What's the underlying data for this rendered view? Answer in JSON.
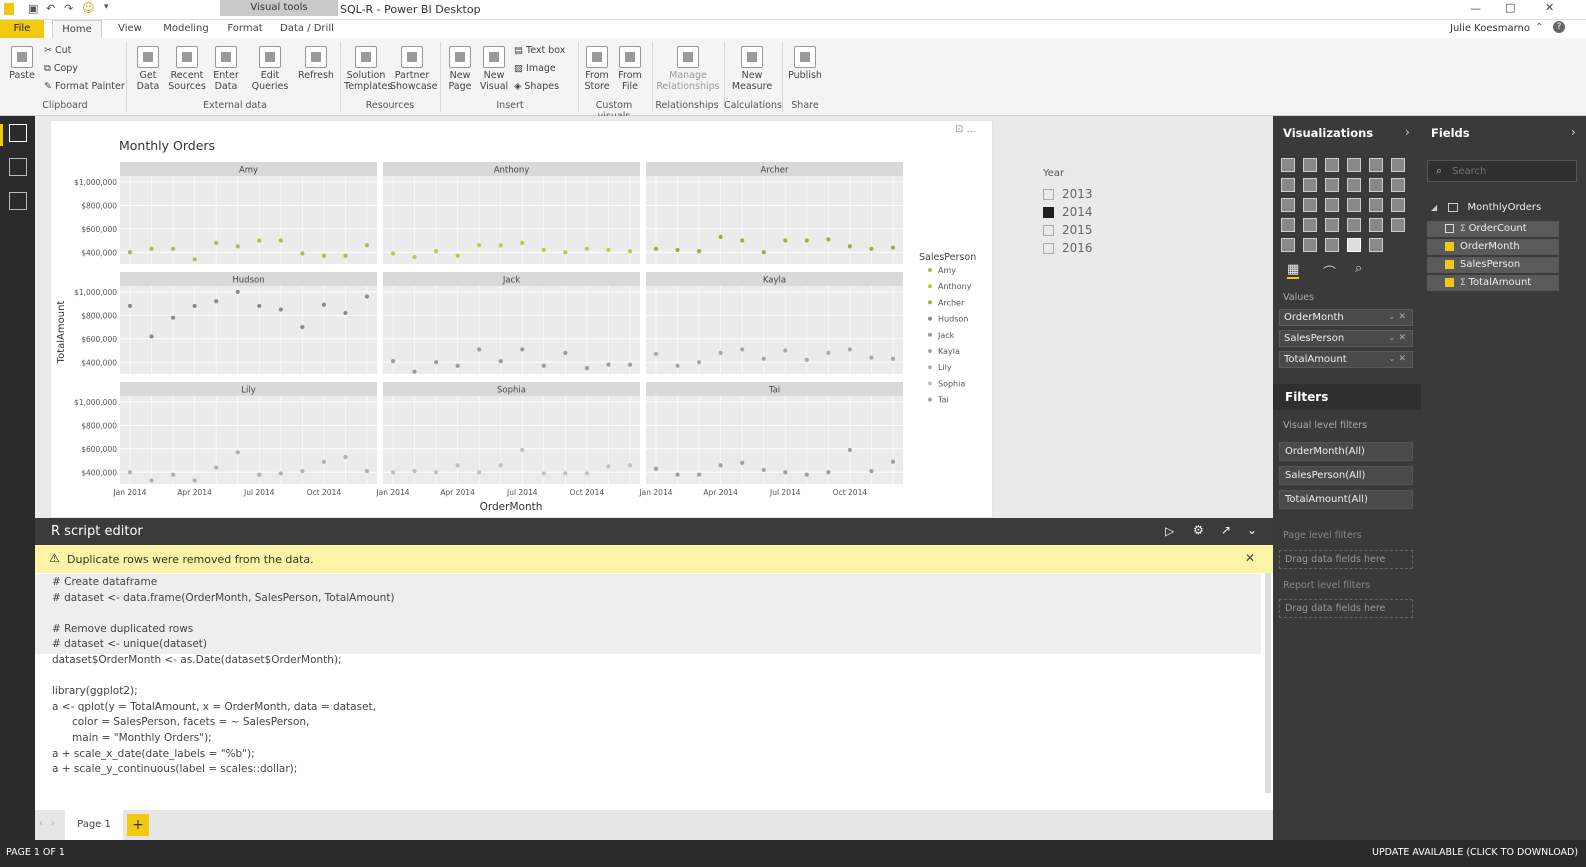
{
  "titlebar": {
    "title": "SQL-R - Power BI Desktop",
    "user": "Julie Koesmarno"
  },
  "tabs": [
    {
      "label": "File"
    },
    {
      "label": "Home"
    },
    {
      "label": "View"
    },
    {
      "label": "Modeling"
    },
    {
      "label": "Format"
    },
    {
      "label": "Data / Drill"
    }
  ],
  "visual_tools_label": "Visual tools",
  "ribbon": {
    "paste": "Paste",
    "cut": "Cut",
    "copy": "Copy",
    "format_painter": "Format Painter",
    "get_data": "Get Data",
    "recent_sources": "Recent Sources",
    "enter_data": "Enter Data",
    "edit_queries": "Edit Queries",
    "refresh": "Refresh",
    "solution_templates": "Solution Templates",
    "partner_showcase": "Partner Showcase",
    "new_page": "New Page",
    "new_visual": "New Visual",
    "text_box": "Text box",
    "image": "Image",
    "shapes": "Shapes",
    "from_store": "From Store",
    "from_file": "From File",
    "manage_relationships": "Manage Relationships",
    "new_measure": "New Measure",
    "publish": "Publish",
    "groups": [
      "Clipboard",
      "External data",
      "Resources",
      "Insert",
      "Custom visuals",
      "Relationships",
      "Calculations",
      "Share"
    ]
  },
  "chart": {
    "title": "Monthly Orders",
    "ylabel": "TotalAmount",
    "xlabel": "OrderMonth",
    "yticks": [
      "$1,000,000",
      "$800,000",
      "$600,000",
      "$400,000"
    ],
    "xticks": [
      "Jan 2014",
      "Apr 2014",
      "Jul 2014",
      "Oct 2014"
    ],
    "legend_title": "SalesPerson",
    "legend_items": [
      "Amy",
      "Anthony",
      "Archer",
      "Hudson",
      "Jack",
      "Kayla",
      "Lily",
      "Sophia",
      "Tai"
    ]
  },
  "chart_data": {
    "type": "scatter",
    "title": "Monthly Orders",
    "xlabel": "OrderMonth",
    "ylabel": "TotalAmount",
    "x": [
      "2014-01",
      "2014-02",
      "2014-03",
      "2014-04",
      "2014-05",
      "2014-06",
      "2014-07",
      "2014-08",
      "2014-09",
      "2014-10",
      "2014-11",
      "2014-12"
    ],
    "ylim": [
      300000,
      1050000
    ],
    "series": [
      {
        "name": "Amy",
        "values": [
          400000,
          430000,
          430000,
          340000,
          480000,
          450000,
          500000,
          500000,
          390000,
          370000,
          370000,
          460000
        ]
      },
      {
        "name": "Anthony",
        "values": [
          390000,
          360000,
          410000,
          370000,
          460000,
          460000,
          480000,
          420000,
          400000,
          430000,
          420000,
          410000
        ]
      },
      {
        "name": "Archer",
        "values": [
          430000,
          420000,
          410000,
          530000,
          500000,
          400000,
          500000,
          500000,
          510000,
          450000,
          430000,
          440000
        ]
      },
      {
        "name": "Hudson",
        "values": [
          880000,
          620000,
          780000,
          880000,
          920000,
          1000000,
          880000,
          850000,
          700000,
          890000,
          820000,
          960000
        ]
      },
      {
        "name": "Jack",
        "values": [
          410000,
          320000,
          400000,
          370000,
          510000,
          410000,
          510000,
          370000,
          480000,
          350000,
          380000,
          380000
        ]
      },
      {
        "name": "Kayla",
        "values": [
          470000,
          370000,
          400000,
          480000,
          510000,
          430000,
          500000,
          420000,
          480000,
          510000,
          440000,
          430000
        ]
      },
      {
        "name": "Lily",
        "values": [
          400000,
          330000,
          380000,
          330000,
          440000,
          570000,
          380000,
          390000,
          410000,
          490000,
          530000,
          410000
        ]
      },
      {
        "name": "Sophia",
        "values": [
          400000,
          410000,
          400000,
          460000,
          400000,
          460000,
          590000,
          390000,
          390000,
          390000,
          450000,
          460000
        ]
      },
      {
        "name": "Tai",
        "values": [
          430000,
          380000,
          380000,
          460000,
          480000,
          420000,
          400000,
          380000,
          400000,
          590000,
          410000,
          490000
        ]
      }
    ],
    "grid": true,
    "legend": "right"
  },
  "slicer": {
    "title": "Year",
    "items": [
      {
        "label": "2013",
        "checked": false
      },
      {
        "label": "2014",
        "checked": true
      },
      {
        "label": "2015",
        "checked": false
      },
      {
        "label": "2016",
        "checked": false
      }
    ]
  },
  "reditor": {
    "title": "R script editor",
    "warning": "Duplicate rows were removed from the data.",
    "lines": [
      "# Create dataframe",
      "# dataset <- data.frame(OrderMonth, SalesPerson, TotalAmount)",
      "",
      "# Remove duplicated rows",
      "# dataset <- unique(dataset)",
      "dataset$OrderMonth <- as.Date(dataset$OrderMonth);",
      "",
      "library(ggplot2);",
      "a <- qplot(y = TotalAmount, x = OrderMonth, data = dataset,",
      "      color = SalesPerson, facets = ~ SalesPerson,",
      "      main = \"Monthly Orders\");",
      "a + scale_x_date(date_labels = \"%b\");",
      "a + scale_y_continuous(label = scales::dollar);"
    ]
  },
  "pages": {
    "current": "Page 1"
  },
  "status": {
    "left": "PAGE 1 OF 1",
    "right": "UPDATE AVAILABLE (CLICK TO DOWNLOAD)"
  },
  "viz": {
    "title": "Visualizations",
    "values_label": "Values",
    "value_fields": [
      "OrderMonth",
      "SalesPerson",
      "TotalAmount"
    ],
    "filters_title": "Filters",
    "visual_filters_label": "Visual level filters",
    "visual_filters": [
      "OrderMonth(All)",
      "SalesPerson(All)",
      "TotalAmount(All)"
    ],
    "page_filters_label": "Page level filters",
    "report_filters_label": "Report level filters",
    "drag_hint": "Drag data fields here"
  },
  "fields": {
    "title": "Fields",
    "search_placeholder": "Search",
    "table": "MonthlyOrders",
    "items": [
      {
        "label": "OrderCount",
        "checked": false
      },
      {
        "label": "OrderMonth",
        "checked": true
      },
      {
        "label": "SalesPerson",
        "checked": true
      },
      {
        "label": "TotalAmount",
        "checked": true
      }
    ]
  },
  "colors": {
    "accent": "#f2c811",
    "dark_pane": "#3a3a3a",
    "warning_bg": "#fbf3a6"
  }
}
